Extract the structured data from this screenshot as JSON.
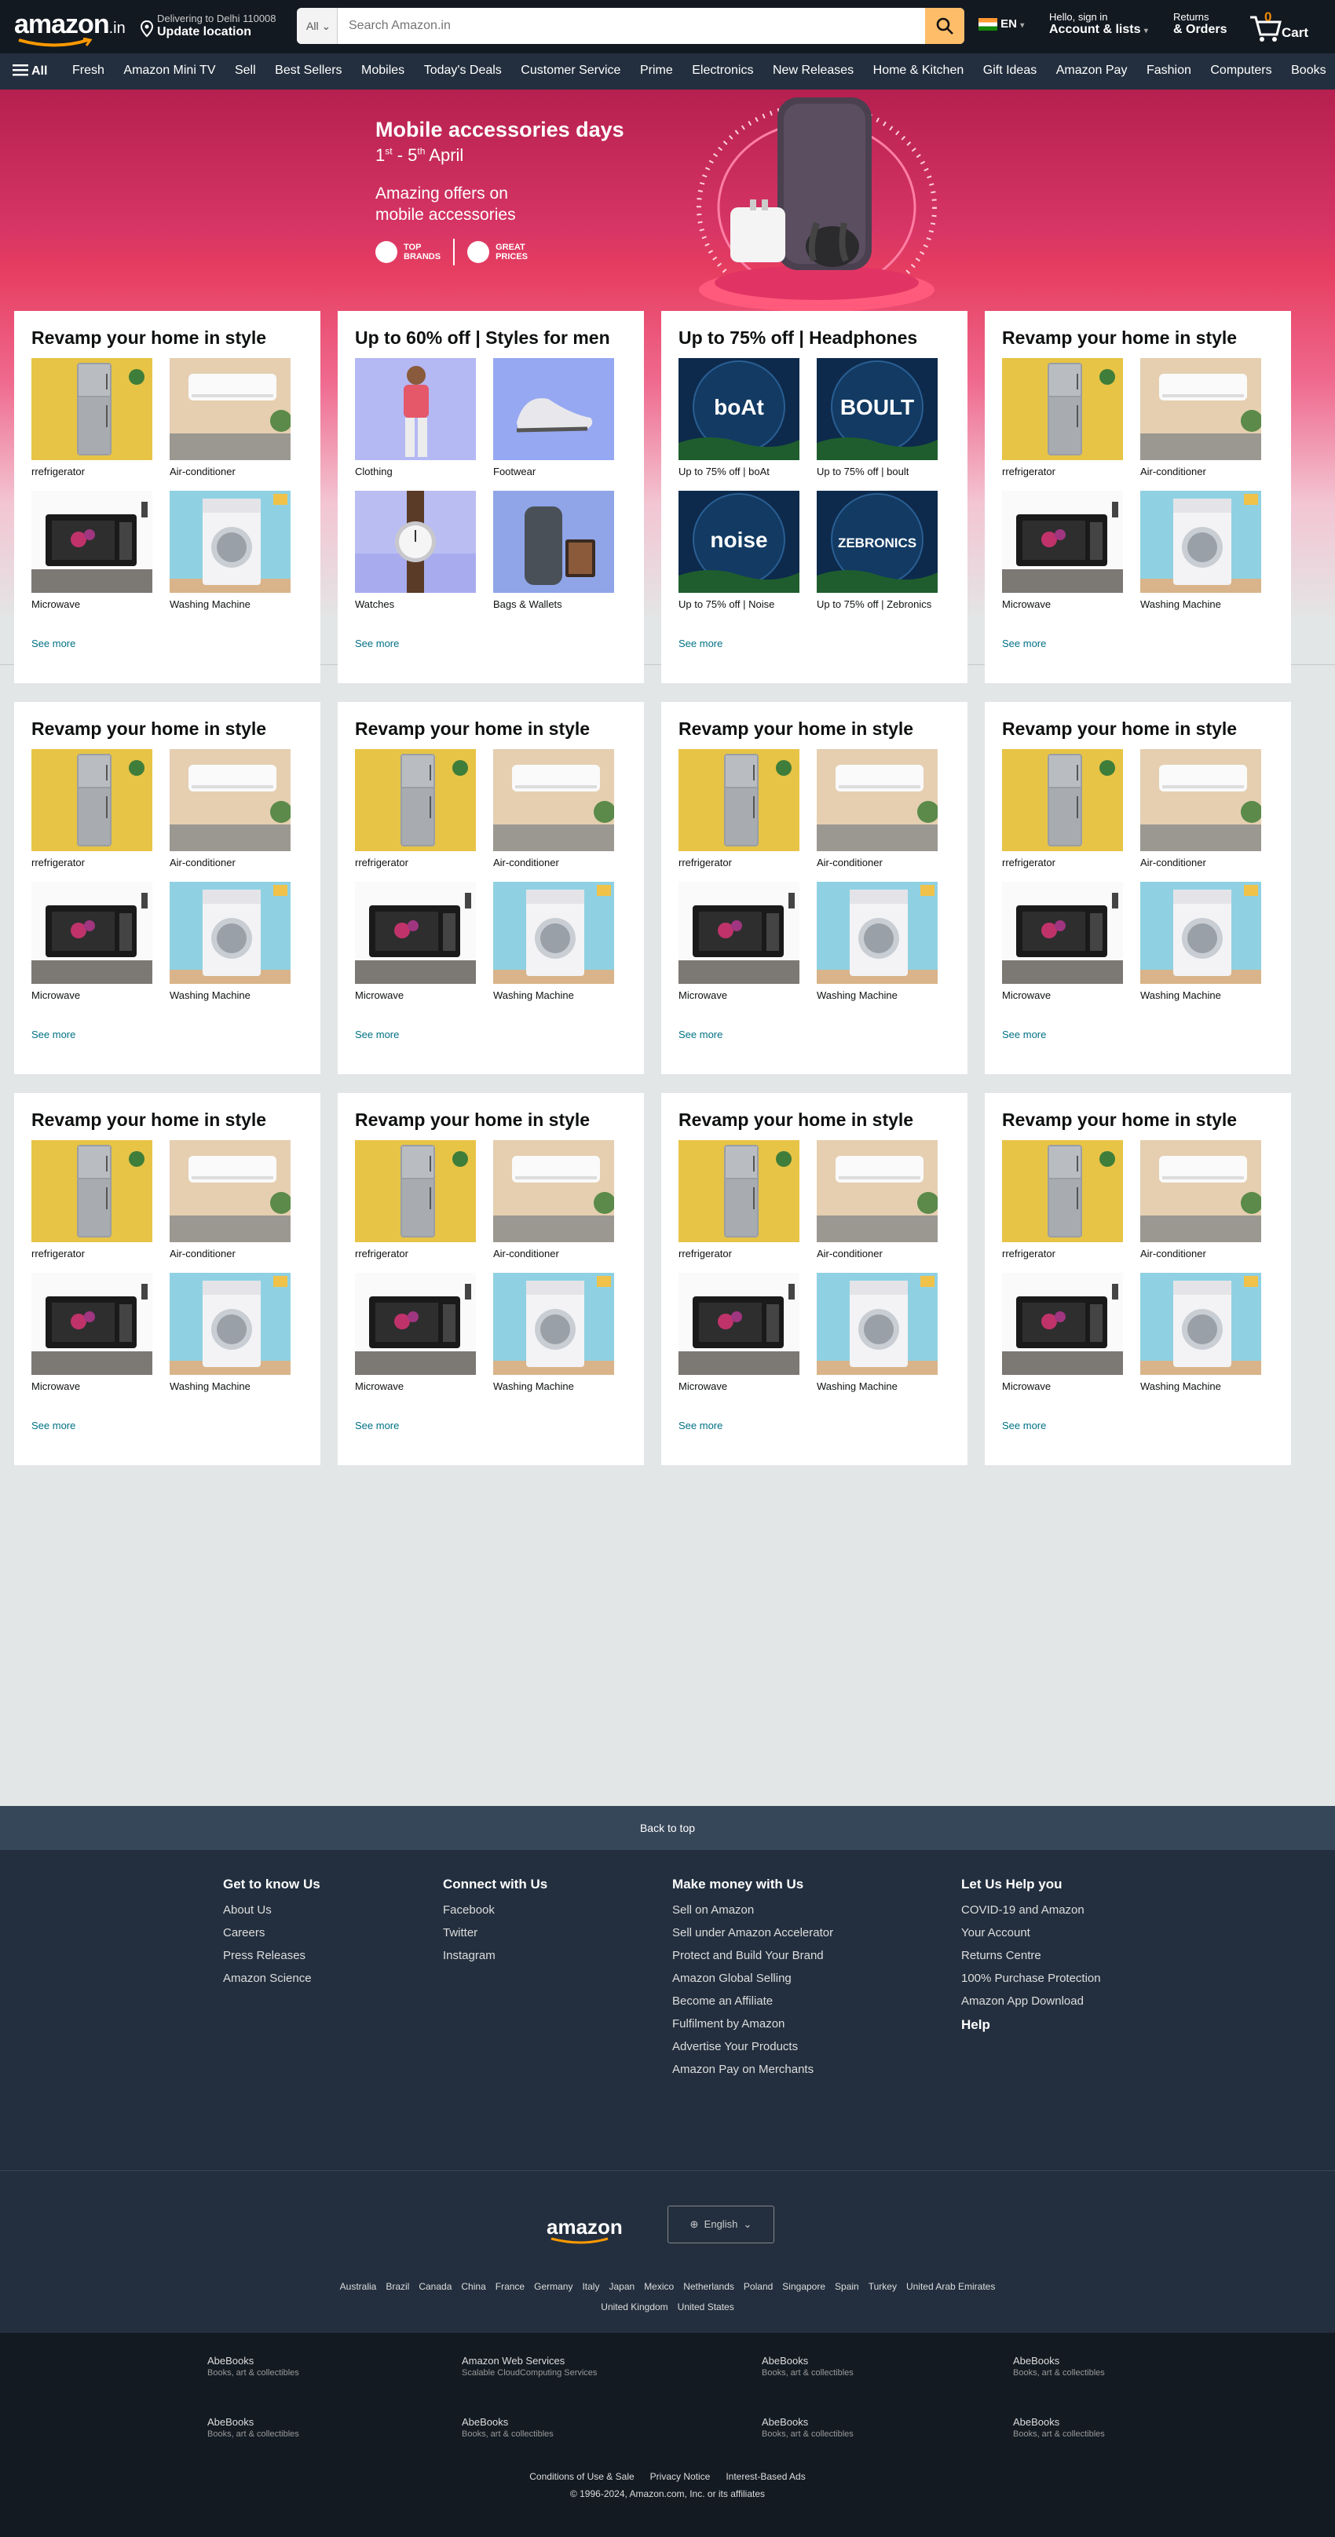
{
  "header": {
    "logo": "amazon",
    "logo_tld": ".in",
    "deliver_line1": "Delivering to Delhi 110008",
    "deliver_line2": "Update location",
    "search_category": "All",
    "search_placeholder": "Search Amazon.in",
    "language": "EN",
    "account_line1": "Hello, sign in",
    "account_line2": "Account & lists",
    "returns_line1": "Returns",
    "returns_line2": "& Orders",
    "cart_count": "0",
    "cart_label": "Cart"
  },
  "subnav": {
    "all_label": "All",
    "items": [
      "Fresh",
      "Amazon Mini TV",
      "Sell",
      "Best Sellers",
      "Mobiles",
      "Today's Deals",
      "Customer Service",
      "Prime",
      "Electronics",
      "New Releases",
      "Home & Kitchen",
      "Gift Ideas",
      "Amazon Pay",
      "Fashion",
      "Computers",
      "Books"
    ]
  },
  "hero": {
    "title": "Mobile accessories days",
    "dates_start": "1",
    "dates_start_sup": "st",
    "dates_mid": " - 5",
    "dates_end_sup": "th",
    "dates_tail": " April",
    "subtitle": "Amazing offers on mobile accessories",
    "badge1_line1": "TOP",
    "badge1_line2": "BRANDS",
    "badge2_line1": "GREAT",
    "badge2_line2": "PRICES",
    "accent": "#d63565"
  },
  "cards": [
    {
      "title": "Revamp your home in style",
      "tiles": [
        {
          "label": "rrefrigerator",
          "img": "fridge"
        },
        {
          "label": "Air-conditioner",
          "img": "ac"
        },
        {
          "label": "Microwave",
          "img": "micro"
        },
        {
          "label": "Washing Machine",
          "img": "wash"
        }
      ],
      "more": "See more"
    },
    {
      "title": "Up to 60% off | Styles for men",
      "tiles": [
        {
          "label": "Clothing",
          "img": "cloth"
        },
        {
          "label": "Footwear",
          "img": "foot"
        },
        {
          "label": "Watches",
          "img": "watch"
        },
        {
          "label": "Bags & Wallets",
          "img": "bag"
        }
      ],
      "more": "See more"
    },
    {
      "title": "Up to 75% off | Headphones",
      "tiles": [
        {
          "label": "Up to 75% off | boAt",
          "img": "brand",
          "brand": "boAt"
        },
        {
          "label": "Up to 75% off | boult",
          "img": "brand",
          "brand": "BOULT"
        },
        {
          "label": "Up to 75% off | Noise",
          "img": "brand",
          "brand": "noise"
        },
        {
          "label": "Up to 75% off | Zebronics",
          "img": "brand",
          "brand": "ZEBRONICS"
        }
      ],
      "more": "See more"
    },
    {
      "title": "Revamp your home in style",
      "tiles": [
        {
          "label": "rrefrigerator",
          "img": "fridge"
        },
        {
          "label": "Air-conditioner",
          "img": "ac"
        },
        {
          "label": "Microwave",
          "img": "micro"
        },
        {
          "label": "Washing Machine",
          "img": "wash"
        }
      ],
      "more": "See more"
    },
    {
      "title": "Revamp your home in style",
      "tiles": [
        {
          "label": "rrefrigerator",
          "img": "fridge"
        },
        {
          "label": "Air-conditioner",
          "img": "ac"
        },
        {
          "label": "Microwave",
          "img": "micro"
        },
        {
          "label": "Washing Machine",
          "img": "wash"
        }
      ],
      "more": "See more"
    },
    {
      "title": "Revamp your home in style",
      "tiles": [
        {
          "label": "rrefrigerator",
          "img": "fridge"
        },
        {
          "label": "Air-conditioner",
          "img": "ac"
        },
        {
          "label": "Microwave",
          "img": "micro"
        },
        {
          "label": "Washing Machine",
          "img": "wash"
        }
      ],
      "more": "See more"
    },
    {
      "title": "Revamp your home in style",
      "tiles": [
        {
          "label": "rrefrigerator",
          "img": "fridge"
        },
        {
          "label": "Air-conditioner",
          "img": "ac"
        },
        {
          "label": "Microwave",
          "img": "micro"
        },
        {
          "label": "Washing Machine",
          "img": "wash"
        }
      ],
      "more": "See more"
    },
    {
      "title": "Revamp your home in style",
      "tiles": [
        {
          "label": "rrefrigerator",
          "img": "fridge"
        },
        {
          "label": "Air-conditioner",
          "img": "ac"
        },
        {
          "label": "Microwave",
          "img": "micro"
        },
        {
          "label": "Washing Machine",
          "img": "wash"
        }
      ],
      "more": "See more"
    },
    {
      "title": "Revamp your home in style",
      "tiles": [
        {
          "label": "rrefrigerator",
          "img": "fridge"
        },
        {
          "label": "Air-conditioner",
          "img": "ac"
        },
        {
          "label": "Microwave",
          "img": "micro"
        },
        {
          "label": "Washing Machine",
          "img": "wash"
        }
      ],
      "more": "See more"
    },
    {
      "title": "Revamp your home in style",
      "tiles": [
        {
          "label": "rrefrigerator",
          "img": "fridge"
        },
        {
          "label": "Air-conditioner",
          "img": "ac"
        },
        {
          "label": "Microwave",
          "img": "micro"
        },
        {
          "label": "Washing Machine",
          "img": "wash"
        }
      ],
      "more": "See more"
    },
    {
      "title": "Revamp your home in style",
      "tiles": [
        {
          "label": "rrefrigerator",
          "img": "fridge"
        },
        {
          "label": "Air-conditioner",
          "img": "ac"
        },
        {
          "label": "Microwave",
          "img": "micro"
        },
        {
          "label": "Washing Machine",
          "img": "wash"
        }
      ],
      "more": "See more"
    },
    {
      "title": "Revamp your home in style",
      "tiles": [
        {
          "label": "rrefrigerator",
          "img": "fridge"
        },
        {
          "label": "Air-conditioner",
          "img": "ac"
        },
        {
          "label": "Microwave",
          "img": "micro"
        },
        {
          "label": "Washing Machine",
          "img": "wash"
        }
      ],
      "more": "See more"
    }
  ],
  "footer": {
    "back_to_top": "Back to top",
    "cols": [
      {
        "title": "Get to know Us",
        "links": [
          "About Us",
          "Careers",
          "Press Releases",
          "Amazon Science"
        ]
      },
      {
        "title": "Connect with Us",
        "links": [
          "Facebook",
          "Twitter",
          "Instagram"
        ]
      },
      {
        "title": "Make money with Us",
        "links": [
          "Sell on Amazon",
          "Sell under Amazon Accelerator",
          "Protect and Build Your Brand",
          "Amazon Global Selling",
          "Become an Affiliate",
          "Fulfilment by Amazon",
          "Advertise Your Products",
          "Amazon Pay on Merchants"
        ]
      },
      {
        "title": "Let Us Help you",
        "links": [
          "COVID-19 and Amazon",
          "Your Account",
          "Returns Centre",
          "100% Purchase Protection",
          "Amazon App Download"
        ],
        "help": "Help"
      }
    ],
    "logo": "amazon",
    "language_button": "English",
    "countries_row1": [
      "Australia",
      "Brazil",
      "Canada",
      "China",
      "France",
      "Germany",
      "Italy",
      "Japan",
      "Mexico",
      "Netherlands",
      "Poland",
      "Singapore",
      "Spain",
      "Turkey",
      "United Arab Emirates"
    ],
    "countries_row2": [
      "United Kingdom",
      "United States"
    ],
    "services": [
      {
        "title": "AbeBooks",
        "sub": "Books, art & collectibles"
      },
      {
        "title": "Amazon Web Services",
        "sub": "Scalable CloudComputing Services"
      },
      {
        "title": "AbeBooks",
        "sub": "Books, art & collectibles"
      },
      {
        "title": "AbeBooks",
        "sub": "Books, art & collectibles"
      },
      {
        "title": "AbeBooks",
        "sub": "Books, art & collectibles"
      },
      {
        "title": "AbeBooks",
        "sub": "Books, art & collectibles"
      },
      {
        "title": "AbeBooks",
        "sub": "Books, art & collectibles"
      },
      {
        "title": "AbeBooks",
        "sub": "Books, art & collectibles"
      }
    ],
    "legal_links": [
      "Conditions of Use & Sale",
      "Privacy Notice",
      "Interest-Based Ads"
    ],
    "copyright": "© 1996-2024, Amazon.com, Inc. or its affiliates"
  }
}
